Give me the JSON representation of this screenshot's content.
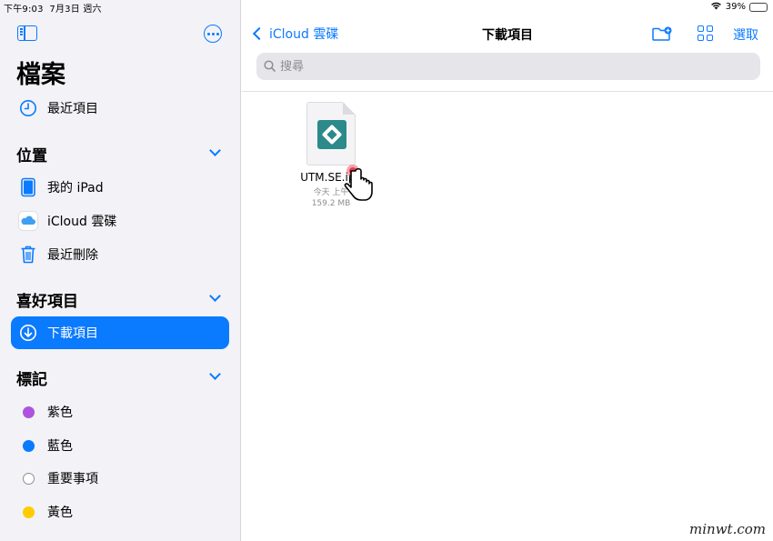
{
  "status_bar": {
    "time": "下午9:03",
    "date": "7月3日 週六",
    "battery": "39%",
    "battery_level": 0.39,
    "wifi_icon": "wifi-icon"
  },
  "sidebar": {
    "title": "檔案",
    "recents_label": "最近項目",
    "locations": {
      "header": "位置",
      "items": [
        {
          "label": "我的 iPad",
          "icon": "ipad-icon"
        },
        {
          "label": "iCloud 雲碟",
          "icon": "icloud-icon"
        },
        {
          "label": "最近刪除",
          "icon": "trash-icon"
        }
      ]
    },
    "favorites": {
      "header": "喜好項目",
      "items": [
        {
          "label": "下載項目",
          "icon": "download-icon",
          "selected": true
        }
      ]
    },
    "tags": {
      "header": "標記",
      "items": [
        {
          "label": "紫色",
          "color": "#af52de"
        },
        {
          "label": "藍色",
          "color": "#0a7aff"
        },
        {
          "label": "重要事項",
          "color": "#ffffff"
        },
        {
          "label": "黃色",
          "color": "#ffcc00"
        }
      ]
    }
  },
  "main": {
    "back_label": "iCloud 雲碟",
    "title": "下載項目",
    "select_label": "選取",
    "search": {
      "placeholder": "搜尋",
      "value": ""
    },
    "files": [
      {
        "name": "UTM.SE.ipa",
        "date": "今天 上午",
        "size": "159.2 MB",
        "icon": "app-file-icon"
      }
    ]
  },
  "watermark": "minwt.com",
  "colors": {
    "accent": "#0a7aff",
    "sidebar_bg": "#f2f2f7",
    "search_bg": "#e5e5ea"
  }
}
